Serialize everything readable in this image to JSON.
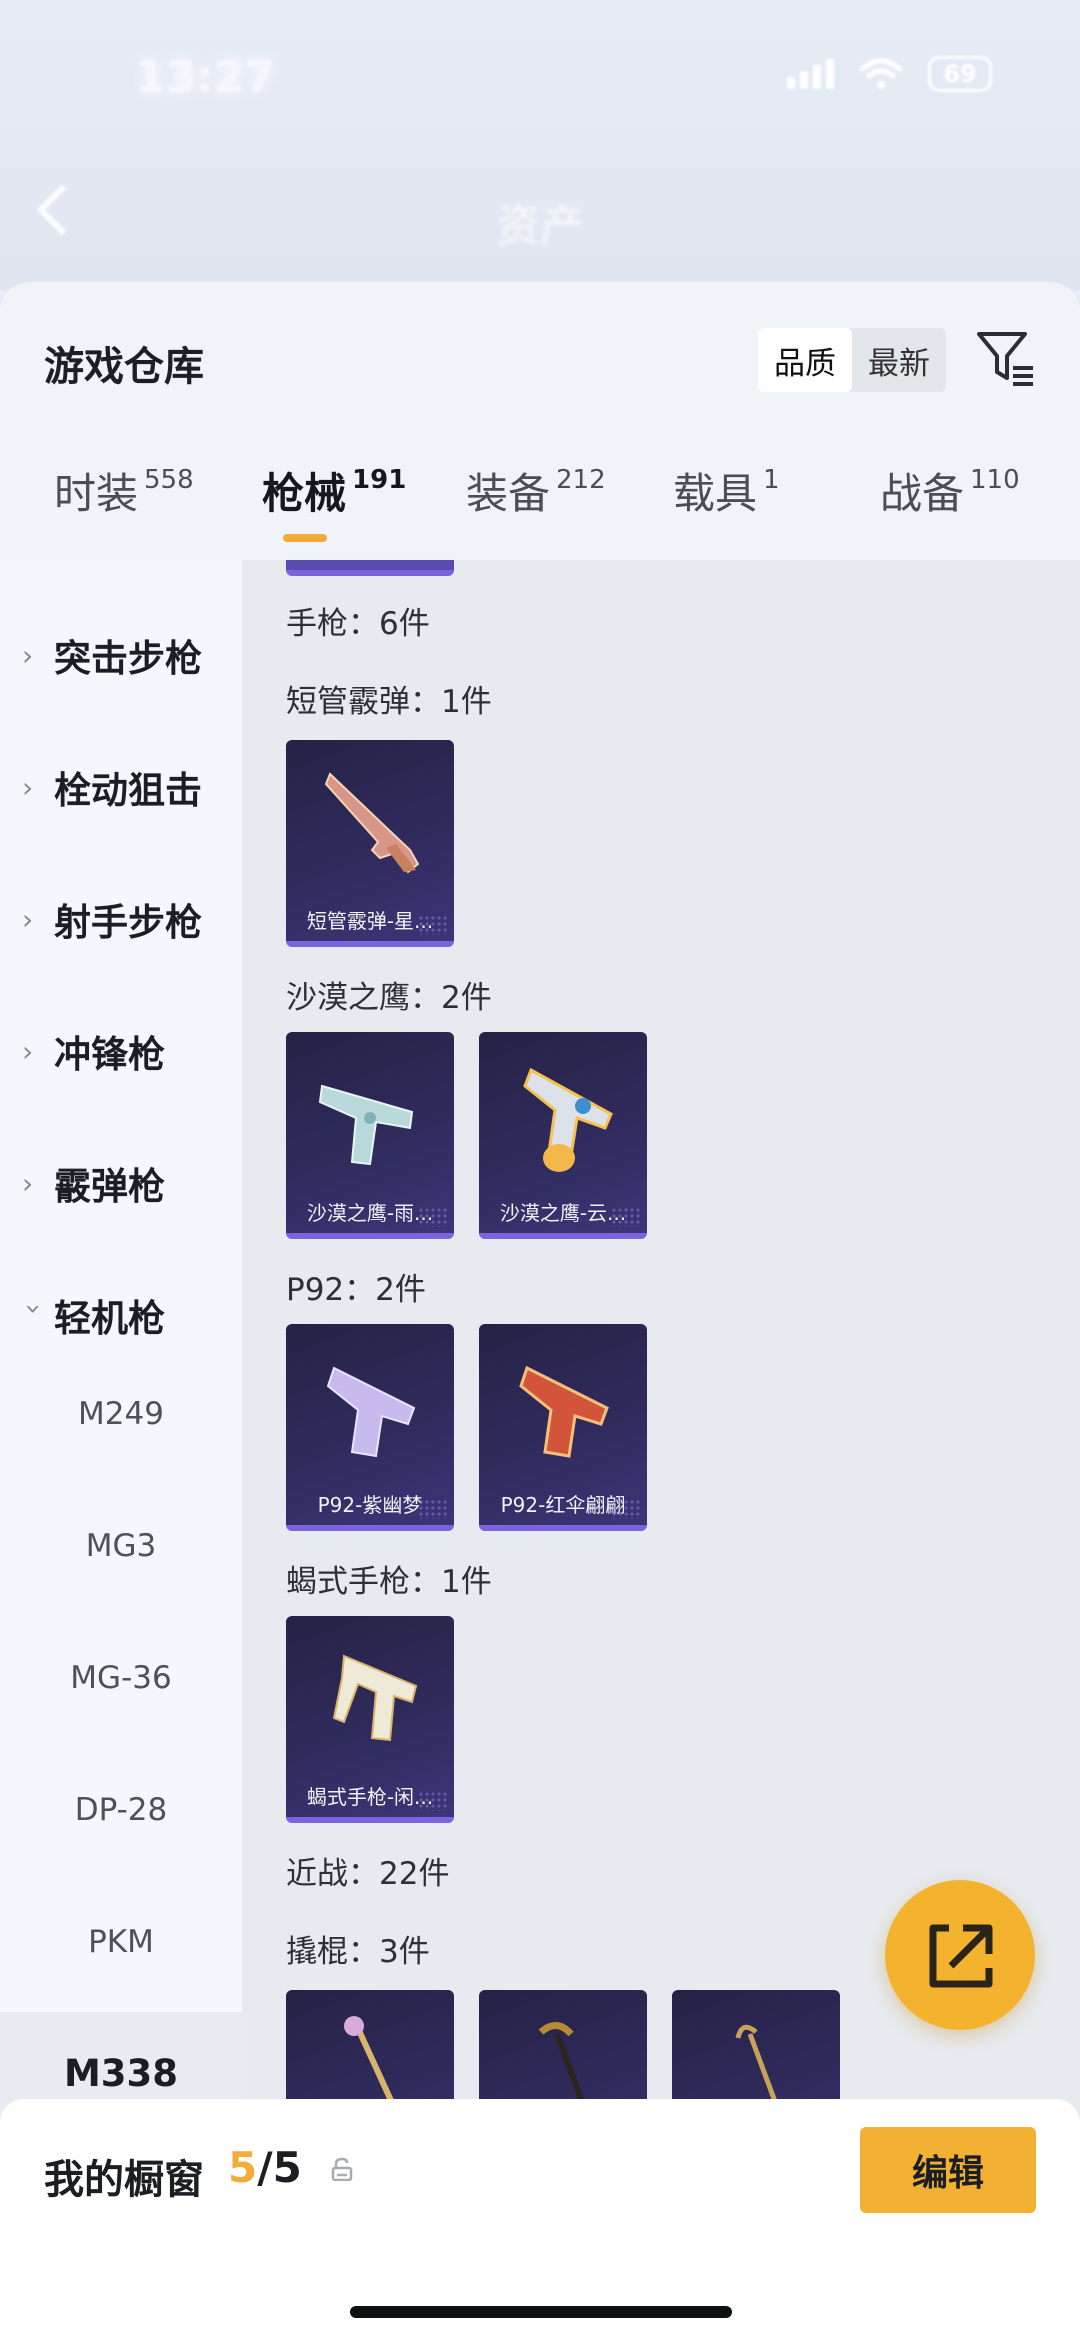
{
  "status_bar": {
    "time": "13:27",
    "battery": "69"
  },
  "header": {
    "title": "资产"
  },
  "sheet": {
    "title": "游戏仓库",
    "sort": {
      "options": [
        "品质",
        "最新"
      ],
      "selected": "品质"
    }
  },
  "tabs": [
    {
      "label": "时装",
      "count": "558"
    },
    {
      "label": "枪械",
      "count": "191",
      "active": true
    },
    {
      "label": "装备",
      "count": "212"
    },
    {
      "label": "载具",
      "count": "1"
    },
    {
      "label": "战备",
      "count": "110"
    }
  ],
  "sidebar": {
    "categories": [
      "突击步枪",
      "栓动狙击",
      "射手步枪",
      "冲锋枪",
      "霰弹枪",
      "轻机枪"
    ],
    "subitems": [
      "M249",
      "MG3",
      "MG-36",
      "DP-28",
      "PKM",
      "M338"
    ]
  },
  "content": {
    "groups": [
      {
        "title": "手枪：6件"
      },
      {
        "title": "短管霰弹：1件",
        "items": [
          "短管霰弹-星..."
        ]
      },
      {
        "title": "沙漠之鹰：2件",
        "items": [
          "沙漠之鹰-雨...",
          "沙漠之鹰-云..."
        ]
      },
      {
        "title": "P92：2件",
        "items": [
          "P92-紫幽梦",
          "P92-红伞翩翩"
        ]
      },
      {
        "title": "蝎式手枪：1件",
        "items": [
          "蝎式手枪-闲..."
        ]
      },
      {
        "title": "近战：22件"
      },
      {
        "title": "撬棍：3件"
      }
    ]
  },
  "showcase": {
    "label": "我的橱窗",
    "current": "5",
    "total": "/5",
    "edit_label": "编辑"
  },
  "colors": {
    "accent": "#f3b134",
    "card_border": "#7a63dd",
    "card_bg": "#2c2854"
  },
  "icons": [
    "back-icon",
    "filter-icon",
    "share-icon",
    "lock-icon",
    "chevron-right-icon",
    "chevron-down-icon"
  ]
}
